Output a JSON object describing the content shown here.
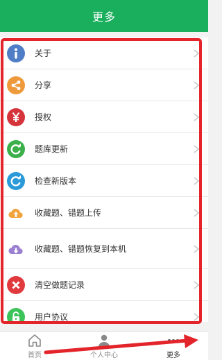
{
  "header": {
    "title": "更多"
  },
  "menu": {
    "items": [
      {
        "label": "关于",
        "icon": "info-icon",
        "color": "#4f7ec6"
      },
      {
        "label": "分享",
        "icon": "share-icon",
        "color": "#ef9a3a"
      },
      {
        "label": "授权",
        "icon": "yen-icon",
        "color": "#d5343b"
      },
      {
        "label": "题库更新",
        "icon": "refresh-icon",
        "color": "#3bb04a"
      },
      {
        "label": "检查新版本",
        "icon": "update-icon",
        "color": "#2b9ad8"
      },
      {
        "label": "收藏题、错题上传",
        "icon": "cloud-upload-icon",
        "color": "#f0a43b"
      },
      {
        "label": "收藏题、错题恢复到本机",
        "icon": "cloud-download-icon",
        "color": "#9b7fd0"
      },
      {
        "label": "清空做题记录",
        "icon": "clear-icon",
        "color": "#e0393e"
      },
      {
        "label": "用户协议",
        "icon": "lock-icon",
        "color": "#3cc35a"
      }
    ]
  },
  "tabbar": {
    "tabs": [
      {
        "label": "首页",
        "icon": "home-icon"
      },
      {
        "label": "个人中心",
        "icon": "user-icon"
      },
      {
        "label": "更多",
        "icon": "more-icon",
        "active": true
      }
    ]
  },
  "colors": {
    "accent": "#1aaf5d",
    "highlight": "#e3242b"
  }
}
